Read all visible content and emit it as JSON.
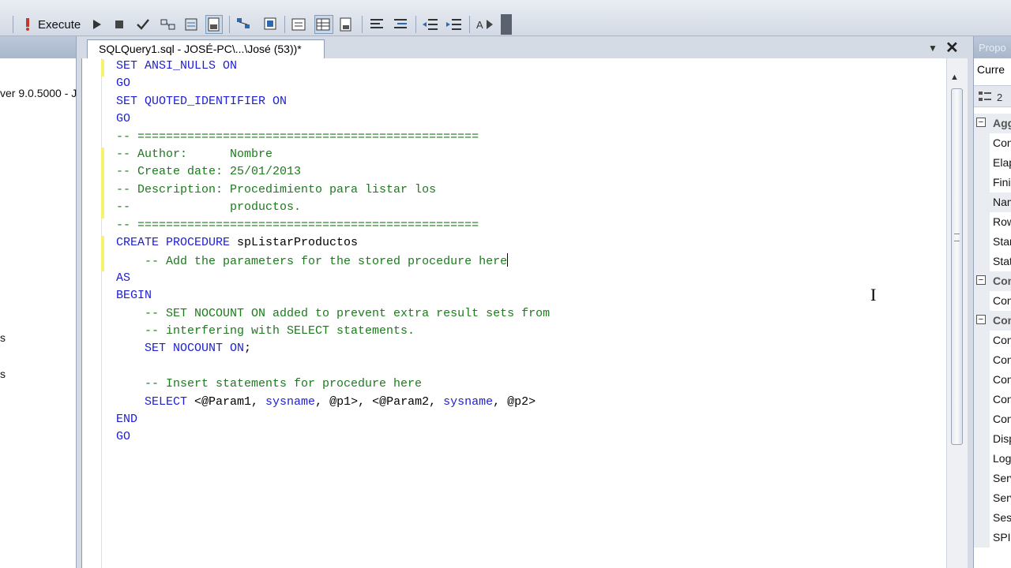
{
  "toolbar": {
    "execute_label": "Execute",
    "icons": [
      "warning-icon",
      "run-icon",
      "stop-icon",
      "parse-check-icon",
      "query-designer-icon",
      "display-plan-icon",
      "estimated-plan-icon",
      "results-to-grid-icon",
      "results-to-text-icon",
      "results-to-file-icon",
      "query-options-icon",
      "include-plan-icon",
      "stats-icon",
      "comment-icon",
      "uncomment-icon",
      "decrease-indent-icon",
      "increase-indent-icon",
      "specify-values-icon"
    ]
  },
  "left_panel": {
    "version_text": "ver 9.0.5000 - J",
    "item_s1": "s",
    "item_s2": "s"
  },
  "editor": {
    "tab_title": "SQLQuery1.sql - JOSÉ-PC\\...\\José (53))*",
    "lines": [
      {
        "parts": [
          {
            "c": "kw",
            "t": "SET ANSI_NULLS ON"
          }
        ]
      },
      {
        "parts": [
          {
            "c": "kw",
            "t": "GO"
          }
        ]
      },
      {
        "parts": [
          {
            "c": "kw",
            "t": "SET QUOTED_IDENTIFIER ON"
          }
        ]
      },
      {
        "parts": [
          {
            "c": "kw",
            "t": "GO"
          }
        ]
      },
      {
        "parts": [
          {
            "c": "cm",
            "t": "-- ================================================"
          }
        ]
      },
      {
        "parts": [
          {
            "c": "cm",
            "t": "-- Author:      Nombre"
          }
        ]
      },
      {
        "parts": [
          {
            "c": "cm",
            "t": "-- Create date: 25/01/2013"
          }
        ]
      },
      {
        "parts": [
          {
            "c": "cm",
            "t": "-- Description: Procedimiento para listar los"
          }
        ]
      },
      {
        "parts": [
          {
            "c": "cm",
            "t": "--              productos."
          }
        ]
      },
      {
        "parts": [
          {
            "c": "cm",
            "t": "-- ================================================"
          }
        ]
      },
      {
        "parts": [
          {
            "c": "kw",
            "t": "CREATE PROCEDURE "
          },
          {
            "c": "",
            "t": "spListarProductos"
          }
        ]
      },
      {
        "parts": [
          {
            "c": "cm",
            "t": "    -- Add the parameters for the stored procedure here"
          }
        ],
        "caret": true
      },
      {
        "parts": [
          {
            "c": "kw",
            "t": "AS"
          }
        ]
      },
      {
        "parts": [
          {
            "c": "kw",
            "t": "BEGIN"
          }
        ]
      },
      {
        "parts": [
          {
            "c": "cm",
            "t": "    -- SET NOCOUNT ON added to prevent extra result sets from"
          }
        ]
      },
      {
        "parts": [
          {
            "c": "cm",
            "t": "    -- interfering with SELECT statements."
          }
        ]
      },
      {
        "parts": [
          {
            "c": "kw",
            "t": "    SET NOCOUNT ON"
          },
          {
            "c": "",
            "t": ";"
          }
        ]
      },
      {
        "parts": [
          {
            "c": "",
            "t": ""
          }
        ]
      },
      {
        "parts": [
          {
            "c": "cm",
            "t": "    -- Insert statements for procedure here"
          }
        ]
      },
      {
        "parts": [
          {
            "c": "kw",
            "t": "    SELECT "
          },
          {
            "c": "",
            "t": "<@Param1, "
          },
          {
            "c": "ty",
            "t": "sysname"
          },
          {
            "c": "",
            "t": ", @p1>, <@Param2, "
          },
          {
            "c": "ty",
            "t": "sysname"
          },
          {
            "c": "",
            "t": ", @p2>"
          }
        ]
      },
      {
        "parts": [
          {
            "c": "kw",
            "t": "END"
          }
        ]
      },
      {
        "parts": [
          {
            "c": "kw",
            "t": "GO"
          }
        ]
      }
    ],
    "changed_blocks": [
      [
        0,
        0
      ],
      [
        5,
        8
      ],
      [
        10,
        11
      ]
    ]
  },
  "properties": {
    "header": "Propo",
    "combo_value": "Curre",
    "rows": [
      {
        "type": "cat",
        "label": "Agg"
      },
      {
        "type": "item",
        "label": "Con"
      },
      {
        "type": "item",
        "label": "Elap"
      },
      {
        "type": "item",
        "label": "Fini"
      },
      {
        "type": "item",
        "label": "Nam",
        "selected": true
      },
      {
        "type": "item",
        "label": "Row"
      },
      {
        "type": "item",
        "label": "Star"
      },
      {
        "type": "item",
        "label": "Stat"
      },
      {
        "type": "cat",
        "label": "Con"
      },
      {
        "type": "item",
        "label": "Con"
      },
      {
        "type": "cat",
        "label": "Con"
      },
      {
        "type": "item",
        "label": "Con"
      },
      {
        "type": "item",
        "label": "Con"
      },
      {
        "type": "item",
        "label": "Con"
      },
      {
        "type": "item",
        "label": "Con"
      },
      {
        "type": "item",
        "label": "Con"
      },
      {
        "type": "item",
        "label": "Disp"
      },
      {
        "type": "item",
        "label": "Logi"
      },
      {
        "type": "item",
        "label": "Serv"
      },
      {
        "type": "item",
        "label": "Serv"
      },
      {
        "type": "item",
        "label": "Sess"
      },
      {
        "type": "item",
        "label": "SPII"
      }
    ]
  }
}
